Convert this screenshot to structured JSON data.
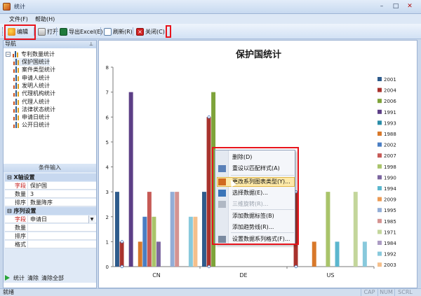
{
  "window": {
    "title": "统计",
    "controls": {
      "minimize": "–",
      "maximize": "□",
      "close": "✕"
    }
  },
  "menu": {
    "items": [
      "文件(F)",
      "帮助(H)"
    ]
  },
  "toolbar": {
    "buttons": [
      {
        "label": "编辑",
        "icon": "edit-icon"
      },
      {
        "label": "打开",
        "icon": "print-icon"
      },
      {
        "label": "导出Excel(E)",
        "icon": "excel-icon"
      },
      {
        "label": "刷新(R)",
        "icon": "refresh-icon"
      },
      {
        "label": "关闭(C)",
        "icon": "close-red-icon"
      }
    ]
  },
  "nav": {
    "title": "导航",
    "pin": "⊥",
    "root": "专利数量统计",
    "items": [
      "保护国统计",
      "案件类型统计",
      "申请人统计",
      "发明人统计",
      "代理机构统计",
      "代理人统计",
      "法律状态统计",
      "申请日统计",
      "公开日统计"
    ],
    "selected_index": 0
  },
  "conditions": {
    "title": "条件输入",
    "x_section": "X轴设置",
    "x_rows": [
      {
        "key": "字段",
        "value": "保护国",
        "key_color": "#c01010"
      },
      {
        "key": "数量",
        "value": "3"
      },
      {
        "key": "排序",
        "value": "数量降序"
      }
    ],
    "series_section": "序列设置",
    "series_rows": [
      {
        "key": "字段",
        "value": "申请日",
        "key_color": "#c01010"
      },
      {
        "key": "数量",
        "value": ""
      },
      {
        "key": "排序",
        "value": ""
      },
      {
        "key": "格式",
        "value": ""
      }
    ],
    "actions": [
      "统计",
      "清除",
      "清除全部"
    ]
  },
  "chart_data": {
    "type": "bar",
    "title": "保护国统计",
    "categories": [
      "CN",
      "DE",
      "US"
    ],
    "ylim": [
      0,
      8
    ],
    "yticks": [
      0,
      1,
      2,
      3,
      4,
      5,
      6,
      7,
      8
    ],
    "grid": false,
    "legend_position": "right",
    "series": [
      {
        "name": "2001",
        "color": "#2e5b8c",
        "values": [
          3,
          3,
          0
        ]
      },
      {
        "name": "2004",
        "color": "#a8322d",
        "values": [
          1,
          6,
          3
        ]
      },
      {
        "name": "2006",
        "color": "#7ea33a",
        "values": [
          0,
          7,
          0
        ]
      },
      {
        "name": "1991",
        "color": "#5c3e86",
        "values": [
          7,
          0,
          0
        ]
      },
      {
        "name": "1993",
        "color": "#2a8da8",
        "values": [
          0,
          0,
          0
        ]
      },
      {
        "name": "1988",
        "color": "#d8782a",
        "values": [
          1,
          0,
          1
        ]
      },
      {
        "name": "2002",
        "color": "#4a7ec3",
        "values": [
          2,
          0,
          0
        ]
      },
      {
        "name": "2007",
        "color": "#c65a56",
        "values": [
          3,
          0,
          0
        ]
      },
      {
        "name": "1998",
        "color": "#a9c46a",
        "values": [
          2,
          0,
          3
        ]
      },
      {
        "name": "1990",
        "color": "#7b659f",
        "values": [
          1,
          0,
          0
        ]
      },
      {
        "name": "1994",
        "color": "#5bb7ce",
        "values": [
          0,
          0,
          1
        ]
      },
      {
        "name": "2009",
        "color": "#eb9a54",
        "values": [
          0,
          0,
          0
        ]
      },
      {
        "name": "1995",
        "color": "#93add6",
        "values": [
          3,
          0,
          0
        ]
      },
      {
        "name": "1985",
        "color": "#d49391",
        "values": [
          3,
          0,
          0
        ]
      },
      {
        "name": "1971",
        "color": "#c3d69b",
        "values": [
          0,
          0,
          3
        ]
      },
      {
        "name": "1984",
        "color": "#ac9cc4",
        "values": [
          0,
          0,
          0
        ]
      },
      {
        "name": "1992",
        "color": "#88c9dc",
        "values": [
          2,
          0,
          1
        ]
      },
      {
        "name": "2003",
        "color": "#f5bf8b",
        "values": [
          2,
          0,
          0
        ]
      }
    ]
  },
  "context_menu": {
    "items": [
      {
        "label": "删除(D)",
        "enabled": true,
        "icon": ""
      },
      {
        "label": "重设以匹配样式(A)",
        "enabled": true,
        "icon": "reset-style-icon"
      },
      {
        "label": "更改系列图表类型(Y)...",
        "enabled": true,
        "icon": "chart-type-icon",
        "hover": true
      },
      {
        "label": "选择数据(E)...",
        "enabled": true,
        "icon": "select-data-icon"
      },
      {
        "label": "三维旋转(R)...",
        "enabled": false,
        "icon": "rotate-3d-icon"
      },
      {
        "label": "添加数据标签(B)",
        "enabled": true,
        "icon": ""
      },
      {
        "label": "添加趋势线(R)...",
        "enabled": true,
        "icon": ""
      },
      {
        "label": "设置数据系列格式(F)...",
        "enabled": true,
        "icon": "format-series-icon"
      }
    ]
  },
  "status": {
    "text": "就绪",
    "indicators": [
      "CAP",
      "NUM",
      "SCRL"
    ]
  }
}
